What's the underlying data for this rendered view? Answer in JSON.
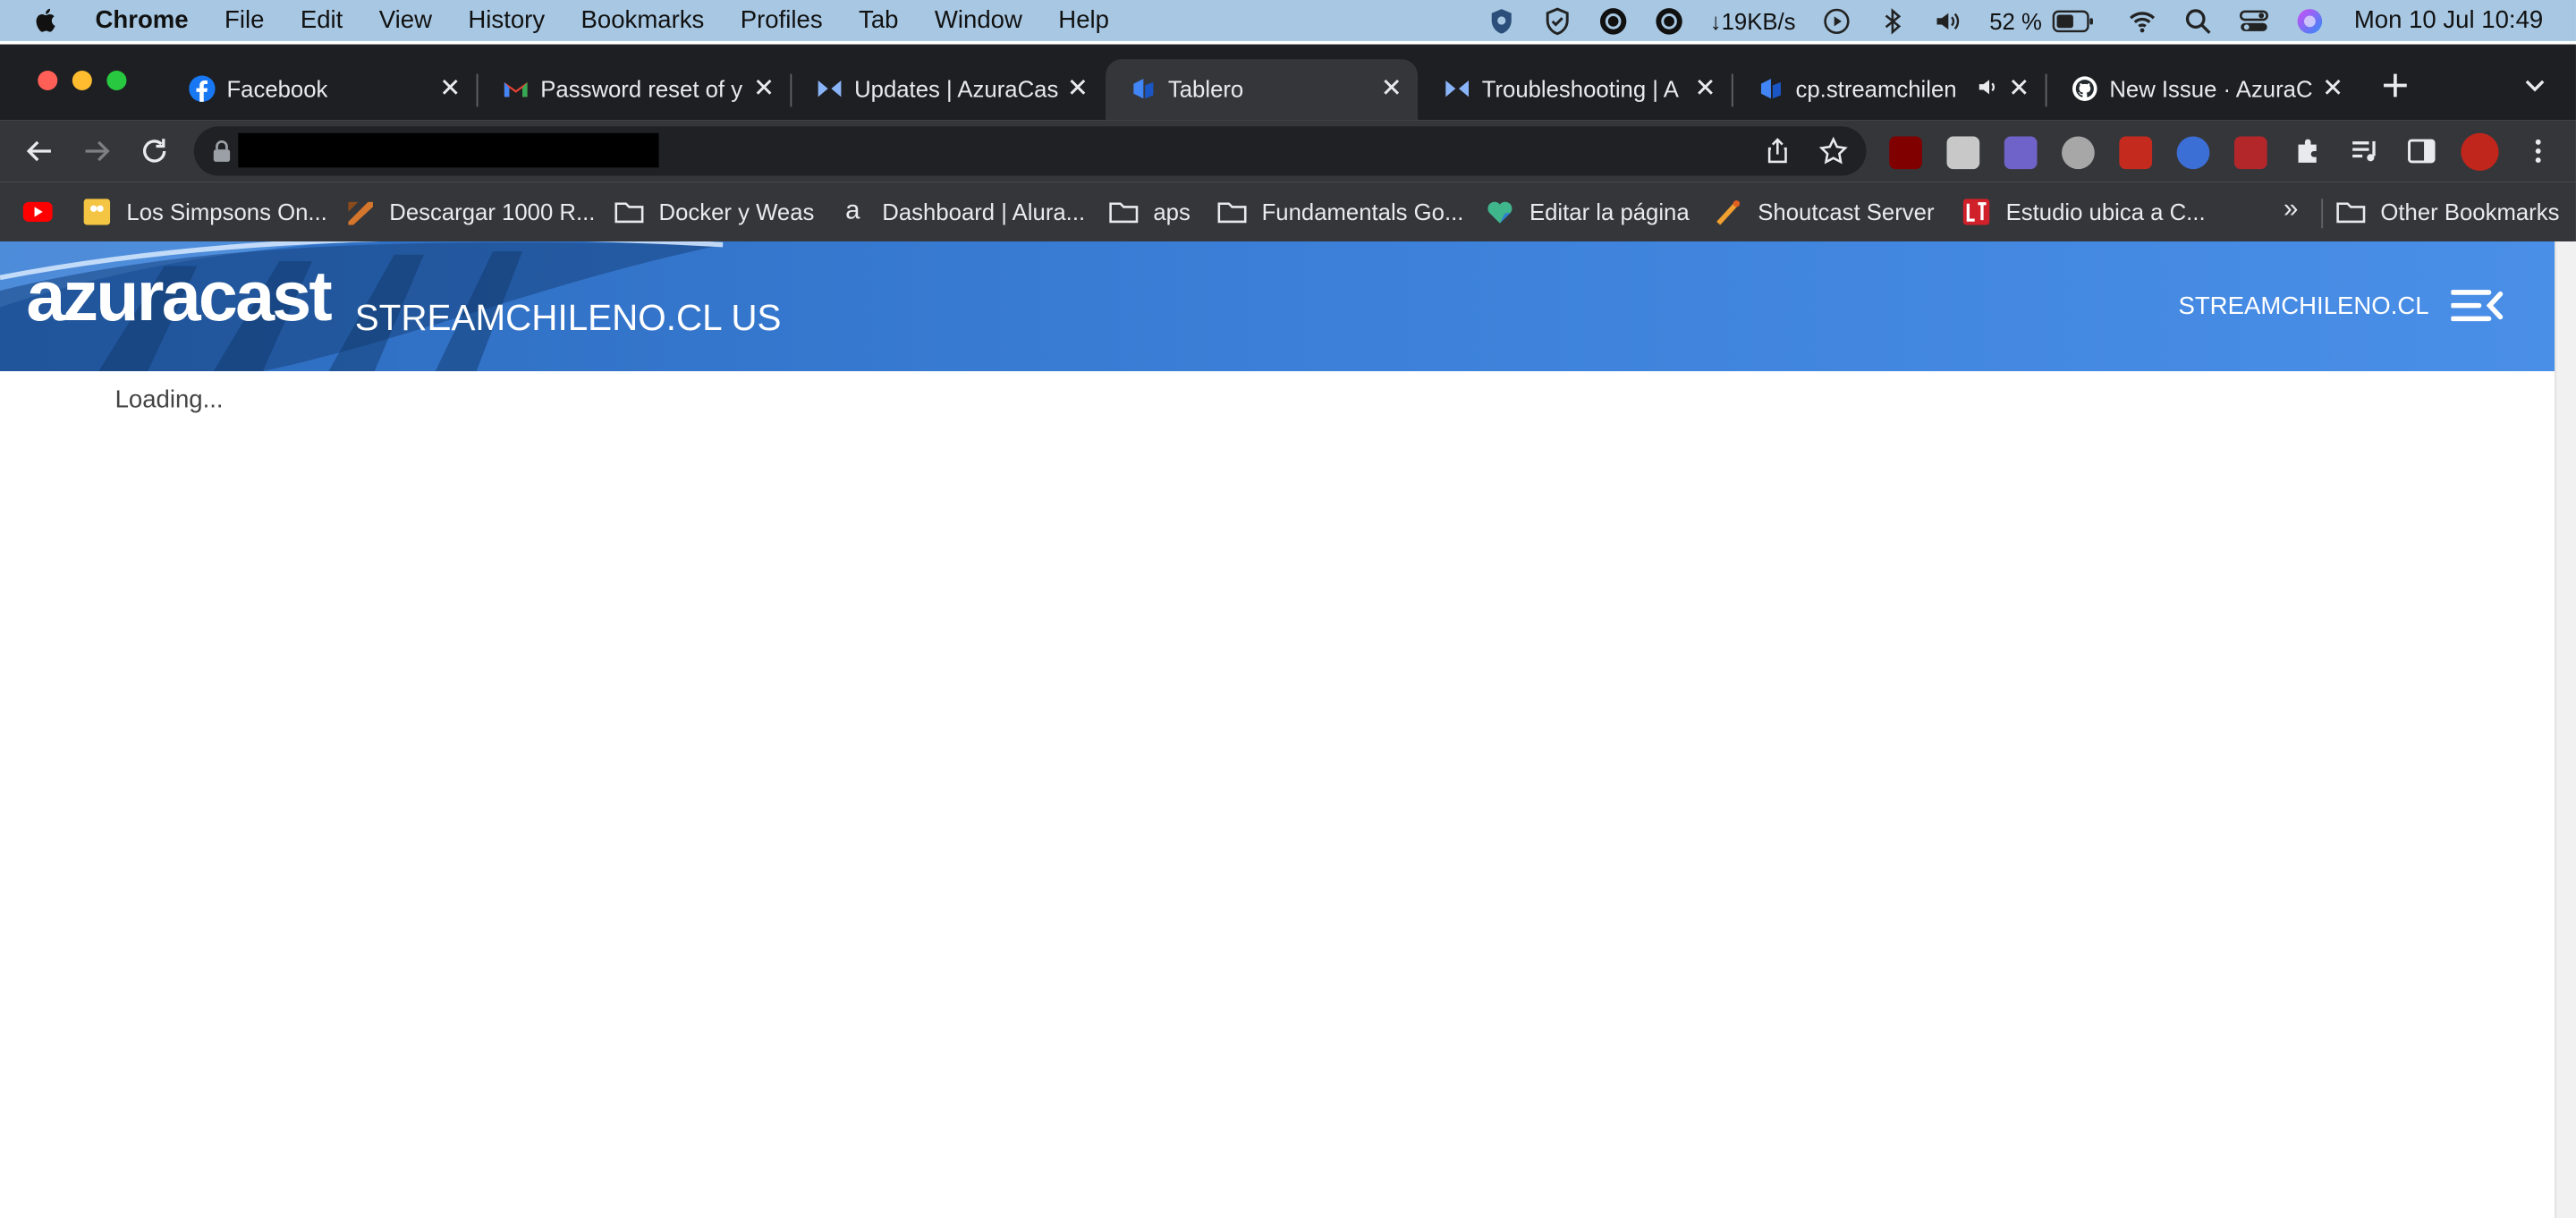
{
  "menubar": {
    "app": "Chrome",
    "menus": [
      "File",
      "Edit",
      "View",
      "History",
      "Bookmarks",
      "Profiles",
      "Tab",
      "Window",
      "Help"
    ],
    "network": "↓19KB/s",
    "battery": "52 %",
    "clock": "Mon 10 Jul  10:49"
  },
  "tabs": [
    {
      "title": "Facebook",
      "icon": "facebook-icon",
      "color": "#1877f2"
    },
    {
      "title": "Password reset of y",
      "icon": "gmail-icon",
      "color": "#ea4335"
    },
    {
      "title": "Updates | AzuraCas",
      "icon": "azuracast-icon",
      "color": "#8ab4f8"
    },
    {
      "title": "Tablero",
      "icon": "tablero-icon",
      "color": "#4285f4"
    },
    {
      "title": "Troubleshooting | A",
      "icon": "azuracast-icon",
      "color": "#8ab4f8"
    },
    {
      "title": "cp.streamchilen",
      "icon": "tablero-icon",
      "color": "#4285f4"
    },
    {
      "title": "New Issue · AzuraC",
      "icon": "github-icon",
      "color": "#ffffff"
    }
  ],
  "bookmarks": [
    {
      "label": "",
      "icon": "youtube-icon"
    },
    {
      "label": "Los Simpsons On...",
      "icon": "simpsons-icon"
    },
    {
      "label": "Descargar 1000 R...",
      "icon": "download-icon"
    },
    {
      "label": "Docker y Weas",
      "icon": "folder-icon"
    },
    {
      "label": "Dashboard | Alura...",
      "icon": "alura-icon"
    },
    {
      "label": "aps",
      "icon": "folder-icon"
    },
    {
      "label": "Fundamentals Go...",
      "icon": "folder-icon"
    },
    {
      "label": "Editar la página",
      "icon": "heart-icon"
    },
    {
      "label": "Shoutcast Server",
      "icon": "shoutcast-icon"
    },
    {
      "label": "Estudio ubica a C...",
      "icon": "lt-icon"
    },
    {
      "label": "Other Bookmarks",
      "icon": "folder-icon"
    }
  ],
  "bookmarks_more": "»",
  "page": {
    "logo": "azuracast",
    "station": "STREAMCHILENO.CL US",
    "nav_link": "STREAMCHILENO.CL",
    "loading": "Loading..."
  },
  "colors": {
    "navbar_start": "#2c6bbd",
    "navbar_end": "#4a8fe7",
    "chrome_dark": "#35363a"
  }
}
